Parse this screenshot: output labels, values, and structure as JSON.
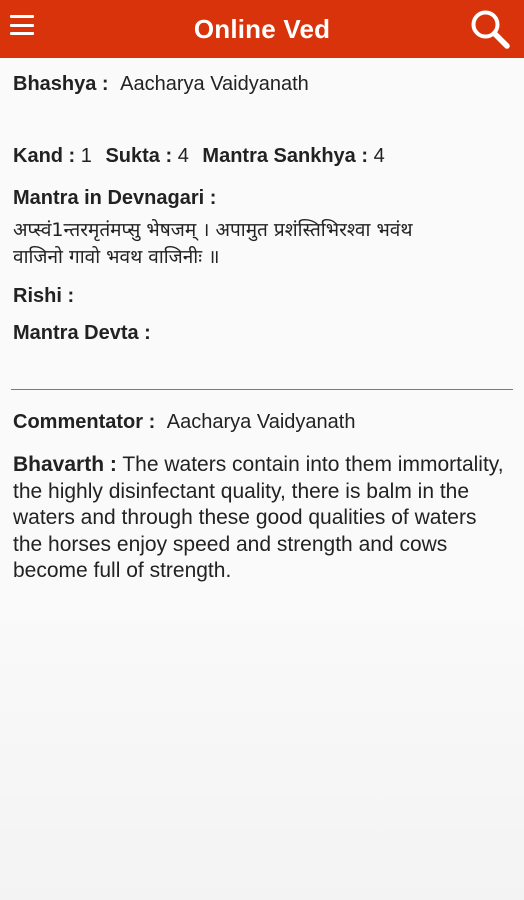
{
  "header": {
    "title": "Online Ved",
    "menu_icon": "hamburger-menu-icon",
    "search_icon": "search-icon",
    "color": "#d8330a"
  },
  "bhashya": {
    "label": "Bhashya :",
    "value": "Aacharya Vaidyanath"
  },
  "location": {
    "kand_label": "Kand :",
    "kand_value": "1",
    "sukta_label": "Sukta :",
    "sukta_value": "4",
    "mantra_label": "Mantra Sankhya :",
    "mantra_value": "4"
  },
  "devnagari": {
    "label": "Mantra in Devnagari :",
    "line1": "अप्स्वं1न्तरमृतंमप्सु भेषजम् । अपामुत प्रशंस्तिभिरश्वा भवंथ",
    "line2": "वाजिनो गावो भवथ वाजिनीः ॥"
  },
  "rishi": {
    "label": "Rishi :",
    "value": ""
  },
  "devta": {
    "label": "Mantra Devta :",
    "value": ""
  },
  "commentator": {
    "label": "Commentator :",
    "value": "Aacharya Vaidyanath"
  },
  "bhavarth": {
    "label": "Bhavarth :",
    "text": "The waters contain into them immortality, the highly disinfectant quality, there is balm in the waters and through these good qualities of waters the horses enjoy speed and strength and cows become full of strength."
  }
}
